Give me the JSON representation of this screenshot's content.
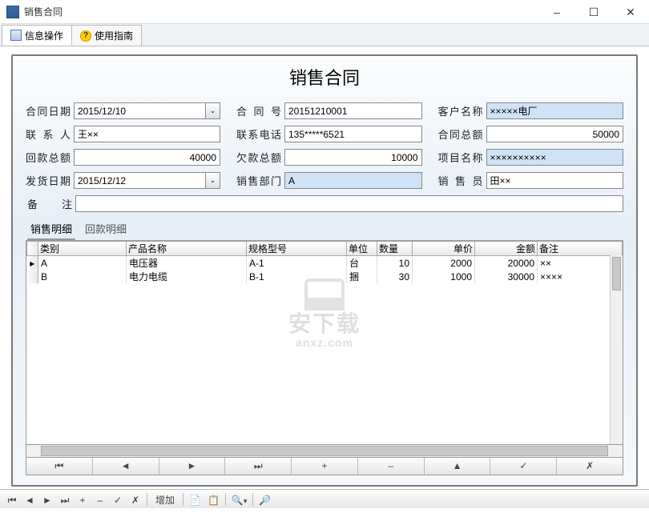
{
  "window": {
    "title": "销售合同"
  },
  "tabs": {
    "info": "信息操作",
    "guide": "使用指南",
    "help_glyph": "?"
  },
  "heading": "销售合同",
  "labels": {
    "contract_date": "合同日期",
    "contract_no": "合 同 号",
    "customer": "客户名称",
    "contact": "联 系 人",
    "phone": "联系电话",
    "total": "合同总额",
    "paid": "回款总额",
    "owed": "欠款总额",
    "project": "项目名称",
    "ship_date": "发货日期",
    "dept": "销售部门",
    "sales": "销 售 员",
    "remarks": "备　　注"
  },
  "values": {
    "contract_date": "2015/12/10",
    "contract_no": "20151210001",
    "customer": "×××××电厂",
    "contact": "王××",
    "phone": "135*****6521",
    "total": "50000",
    "paid": "40000",
    "owed": "10000",
    "project": "××××××××××",
    "ship_date": "2015/12/12",
    "dept": "A",
    "sales": "田××",
    "remarks": ""
  },
  "subtabs": {
    "detail": "销售明细",
    "payback": "回款明细"
  },
  "grid": {
    "cols": {
      "cat": "类别",
      "name": "产品名称",
      "spec": "规格型号",
      "unit": "单位",
      "qty": "数量",
      "price": "单价",
      "amt": "金额",
      "note": "备注"
    },
    "rows": [
      {
        "cat": "A",
        "name": "电压器",
        "spec": "A-1",
        "unit": "台",
        "qty": "10",
        "price": "2000",
        "amt": "20000",
        "note": "××"
      },
      {
        "cat": "B",
        "name": "电力电缆",
        "spec": "B-1",
        "unit": "捆",
        "qty": "30",
        "price": "1000",
        "amt": "30000",
        "note": "××××"
      }
    ]
  },
  "nav": {
    "first": "⏮",
    "prev": "◄",
    "next": "►",
    "last": "⏭",
    "add": "+",
    "del": "‒",
    "edit": "▲",
    "ok": "✓",
    "cancel": "✗"
  },
  "bottom": {
    "first": "⏮",
    "prev": "◄",
    "next": "►",
    "last": "⏭",
    "add": "+",
    "del": "‒",
    "ok": "✓",
    "cancel": "✗",
    "add_text": "增加"
  },
  "watermark": {
    "title": "安下载",
    "sub": "anxz.com"
  }
}
